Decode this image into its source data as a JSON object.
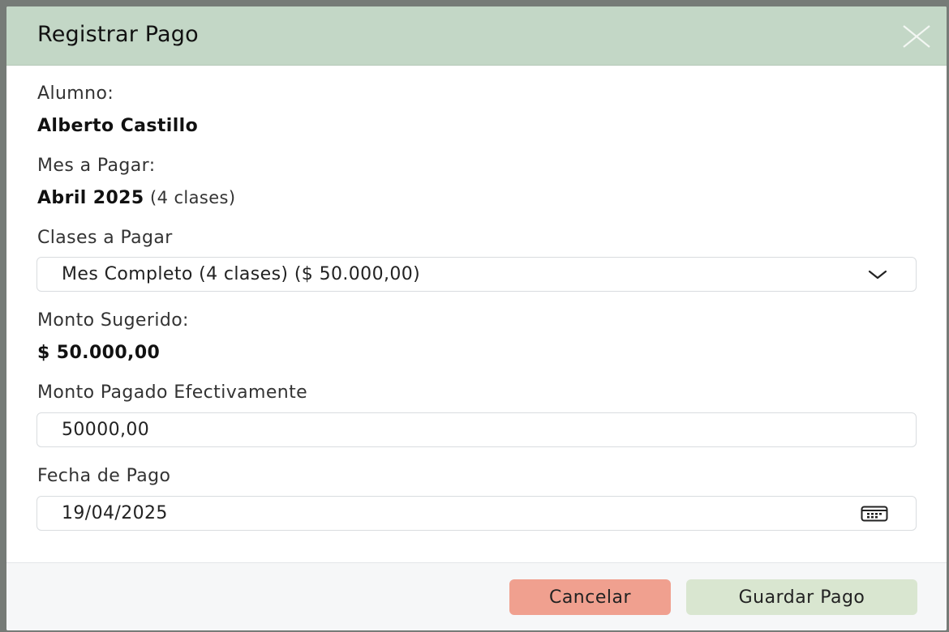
{
  "modal": {
    "title": "Registrar Pago",
    "close_icon": "close-icon"
  },
  "student": {
    "label": "Alumno:",
    "name": "Alberto Castillo"
  },
  "month": {
    "label": "Mes a Pagar:",
    "value": "Abril 2025",
    "note": "(4 clases)"
  },
  "classes": {
    "label": "Clases a Pagar",
    "selected": "Mes Completo (4 clases) ($ 50.000,00)",
    "icon": "chevron-down-icon"
  },
  "suggested": {
    "label": "Monto Sugerido:",
    "value": "$ 50.000,00"
  },
  "paid": {
    "label": "Monto Pagado Efectivamente",
    "value": "50000,00"
  },
  "date": {
    "label": "Fecha de Pago",
    "value": "19/04/2025",
    "icon": "calendar-icon"
  },
  "footer": {
    "cancel_label": "Cancelar",
    "save_label": "Guardar Pago"
  },
  "colors": {
    "header_bg": "#c3d7c6",
    "cancel_bg": "#f0a08f",
    "save_bg": "#d9e6d0",
    "footer_bg": "#f6f7f8"
  }
}
